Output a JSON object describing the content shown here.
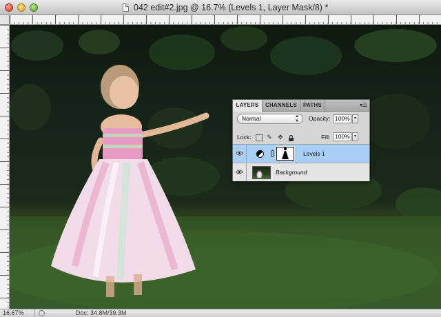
{
  "window": {
    "title": "042 edit#2.jpg @ 16.7% (Levels 1, Layer Mask/8) *"
  },
  "status_bar": {
    "zoom": "16.67%",
    "doc_size": "Doc: 34.8M/39.3M"
  },
  "layers_panel": {
    "tabs": [
      {
        "label": "LAYERS",
        "active": true
      },
      {
        "label": "CHANNELS",
        "active": false
      },
      {
        "label": "PATHS",
        "active": false
      }
    ],
    "blend_mode": "Normal",
    "opacity_label": "Opacity:",
    "opacity_value": "100%",
    "lock_label": "Lock:",
    "fill_label": "Fill:",
    "fill_value": "100%",
    "layers": [
      {
        "name": "Levels 1",
        "selected": true,
        "visible": true,
        "type": "adjustment-with-mask"
      },
      {
        "name": "Background",
        "selected": false,
        "visible": true,
        "type": "image"
      }
    ]
  },
  "colors": {
    "selected_layer": "#a9cef5",
    "panel_bg": "#d6d6d6"
  }
}
